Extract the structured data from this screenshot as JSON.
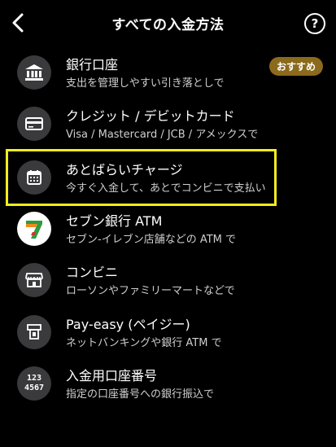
{
  "header": {
    "title": "すべての入金方法",
    "help_symbol": "?"
  },
  "methods": [
    {
      "label": "銀行口座",
      "sub": "支出を管理しやすい引き落としで",
      "icon": "bank-icon",
      "badge": "おすすめ"
    },
    {
      "label": "クレジット / デビットカード",
      "sub": "Visa / Mastercard / JCB / アメックスで",
      "icon": "credit-card-icon"
    },
    {
      "label": "あとばらいチャージ",
      "sub": "今すぐ入金して、あとでコンビニで支払い",
      "icon": "calendar-icon",
      "highlighted": true
    },
    {
      "label": "セブン銀行 ATM",
      "sub": "セブン-イレブン店舗などの ATM で",
      "icon": "seven-bank-logo"
    },
    {
      "label": "コンビニ",
      "sub": "ローソンやファミリーマートなどで",
      "icon": "store-icon"
    },
    {
      "label": "Pay-easy (ペイジー)",
      "sub": "ネットバンキングや銀行 ATM で",
      "icon": "atm-icon"
    },
    {
      "label": "入金用口座番号",
      "sub": "指定の口座番号への銀行振込で",
      "icon": "account-number-icon",
      "icon_text": [
        "123",
        "4567"
      ]
    }
  ],
  "colors": {
    "background": "#000000",
    "icon_circle": "#3a3a3c",
    "badge": "#8b6a1c",
    "highlight": "#f4ec1f"
  }
}
